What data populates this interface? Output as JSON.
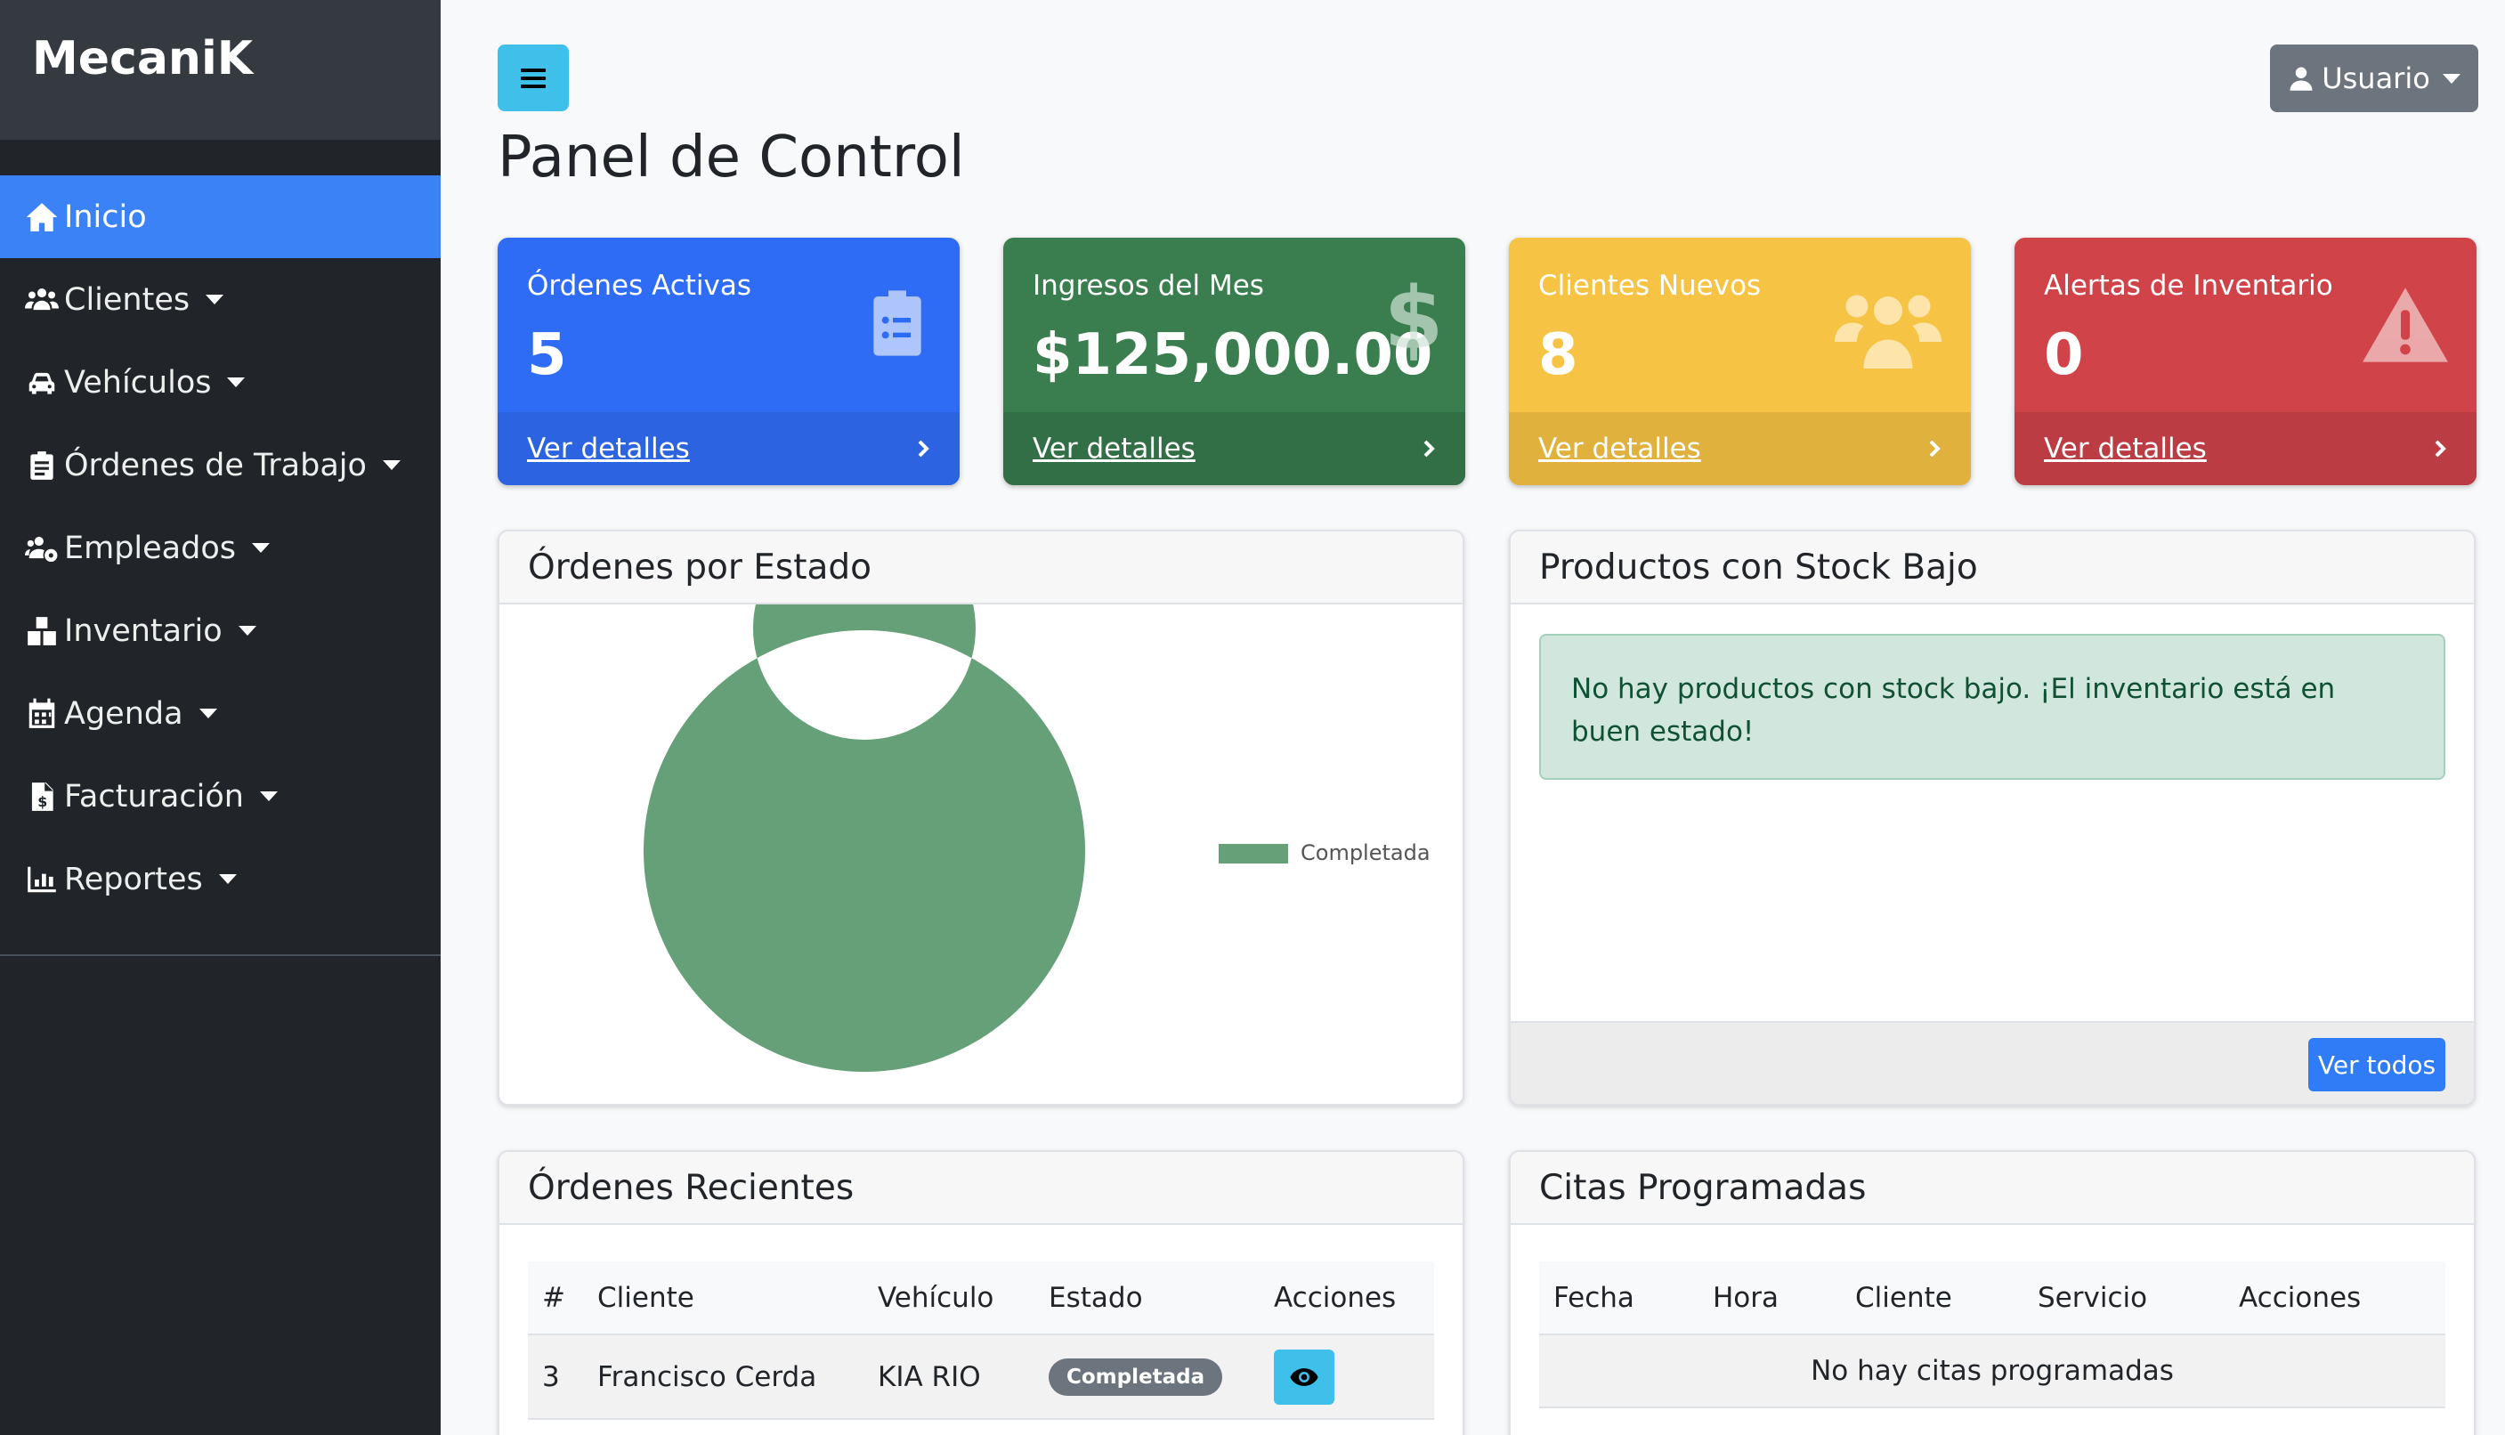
{
  "app": {
    "brand": "MecaniK"
  },
  "sidebar": {
    "items": [
      {
        "label": "Inicio",
        "icon": "home-icon",
        "active": true,
        "dropdown": false
      },
      {
        "label": "Clientes",
        "icon": "users-icon",
        "active": false,
        "dropdown": true
      },
      {
        "label": "Vehículos",
        "icon": "car-icon",
        "active": false,
        "dropdown": true
      },
      {
        "label": "Órdenes de Trabajo",
        "icon": "clipboard-icon",
        "active": false,
        "dropdown": true
      },
      {
        "label": "Empleados",
        "icon": "users-gear-icon",
        "active": false,
        "dropdown": true
      },
      {
        "label": "Inventario",
        "icon": "boxes-icon",
        "active": false,
        "dropdown": true
      },
      {
        "label": "Agenda",
        "icon": "calendar-icon",
        "active": false,
        "dropdown": true
      },
      {
        "label": "Facturación",
        "icon": "invoice-icon",
        "active": false,
        "dropdown": true
      },
      {
        "label": "Reportes",
        "icon": "chart-icon",
        "active": false,
        "dropdown": true
      }
    ]
  },
  "header": {
    "user_label": "Usuario",
    "page_title": "Panel de Control"
  },
  "stats": [
    {
      "label": "Órdenes Activas",
      "value": "5",
      "link": "Ver detalles",
      "color": "#2e6cf5",
      "footer_color": "#2b63e0",
      "icon": "clipboard-list-icon"
    },
    {
      "label": "Ingresos del Mes",
      "value": "$125,000.00",
      "link": "Ver detalles",
      "color": "#3a7e4f",
      "footer_color": "#336f46",
      "icon": "dollar-icon"
    },
    {
      "label": "Clientes Nuevos",
      "value": "8",
      "link": "Ver detalles",
      "color": "#f6c344",
      "footer_color": "#e0b13d",
      "icon": "users-icon"
    },
    {
      "label": "Alertas de Inventario",
      "value": "0",
      "link": "Ver detalles",
      "color": "#d04349",
      "footer_color": "#bb3c42",
      "icon": "warning-icon"
    }
  ],
  "orders_by_status": {
    "title": "Órdenes por Estado",
    "chart_data": {
      "type": "pie",
      "categories": [
        "Completada"
      ],
      "values": [
        1
      ],
      "colors": [
        "#65a078"
      ],
      "legend": "right"
    }
  },
  "low_stock": {
    "title": "Productos con Stock Bajo",
    "message": "No hay productos con stock bajo. ¡El inventario está en buen estado!",
    "button": "Ver todos"
  },
  "recent_orders": {
    "title": "Órdenes Recientes",
    "columns": [
      "#",
      "Cliente",
      "Vehículo",
      "Estado",
      "Acciones"
    ],
    "rows": [
      {
        "id": "3",
        "client": "Francisco Cerda",
        "vehicle": "KIA RIO",
        "status": "Completada"
      }
    ]
  },
  "appointments": {
    "title": "Citas Programadas",
    "columns": [
      "Fecha",
      "Hora",
      "Cliente",
      "Servicio",
      "Acciones"
    ],
    "empty": "No hay citas programadas"
  }
}
